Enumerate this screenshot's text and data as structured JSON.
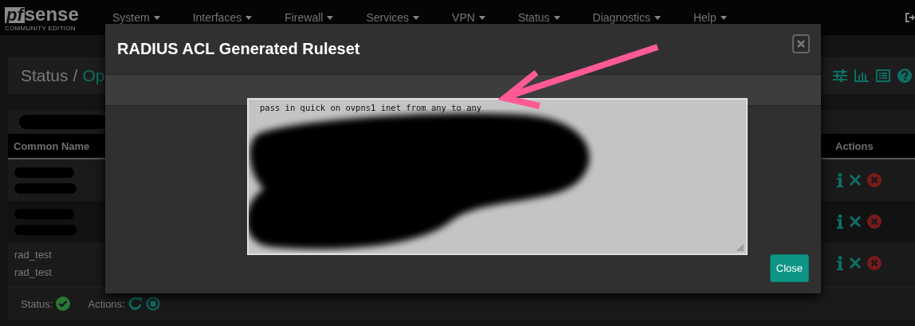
{
  "nav": {
    "logo_prefix": "pf",
    "logo_name": "sense",
    "edition": "COMMUNITY EDITION",
    "menu": [
      "System",
      "Interfaces",
      "Firewall",
      "Services",
      "VPN",
      "Status",
      "Diagnostics",
      "Help"
    ]
  },
  "breadcrumb": {
    "parent": "Status",
    "separator": "/",
    "current": "Op"
  },
  "table": {
    "columns": [
      "Common Name",
      "Actions"
    ],
    "rows": [
      {
        "redacted": true,
        "names": []
      },
      {
        "redacted": true,
        "names": []
      },
      {
        "redacted": false,
        "names": [
          "rad_test",
          "rad_test"
        ]
      }
    ]
  },
  "footer": {
    "status_label": "Status:",
    "actions_label": "Actions:"
  },
  "modal": {
    "title": "RADIUS ACL Generated Ruleset",
    "ruleset": "pass in quick on ovpns1 inet from any to any",
    "redacted": true,
    "close_button": "Close"
  }
}
